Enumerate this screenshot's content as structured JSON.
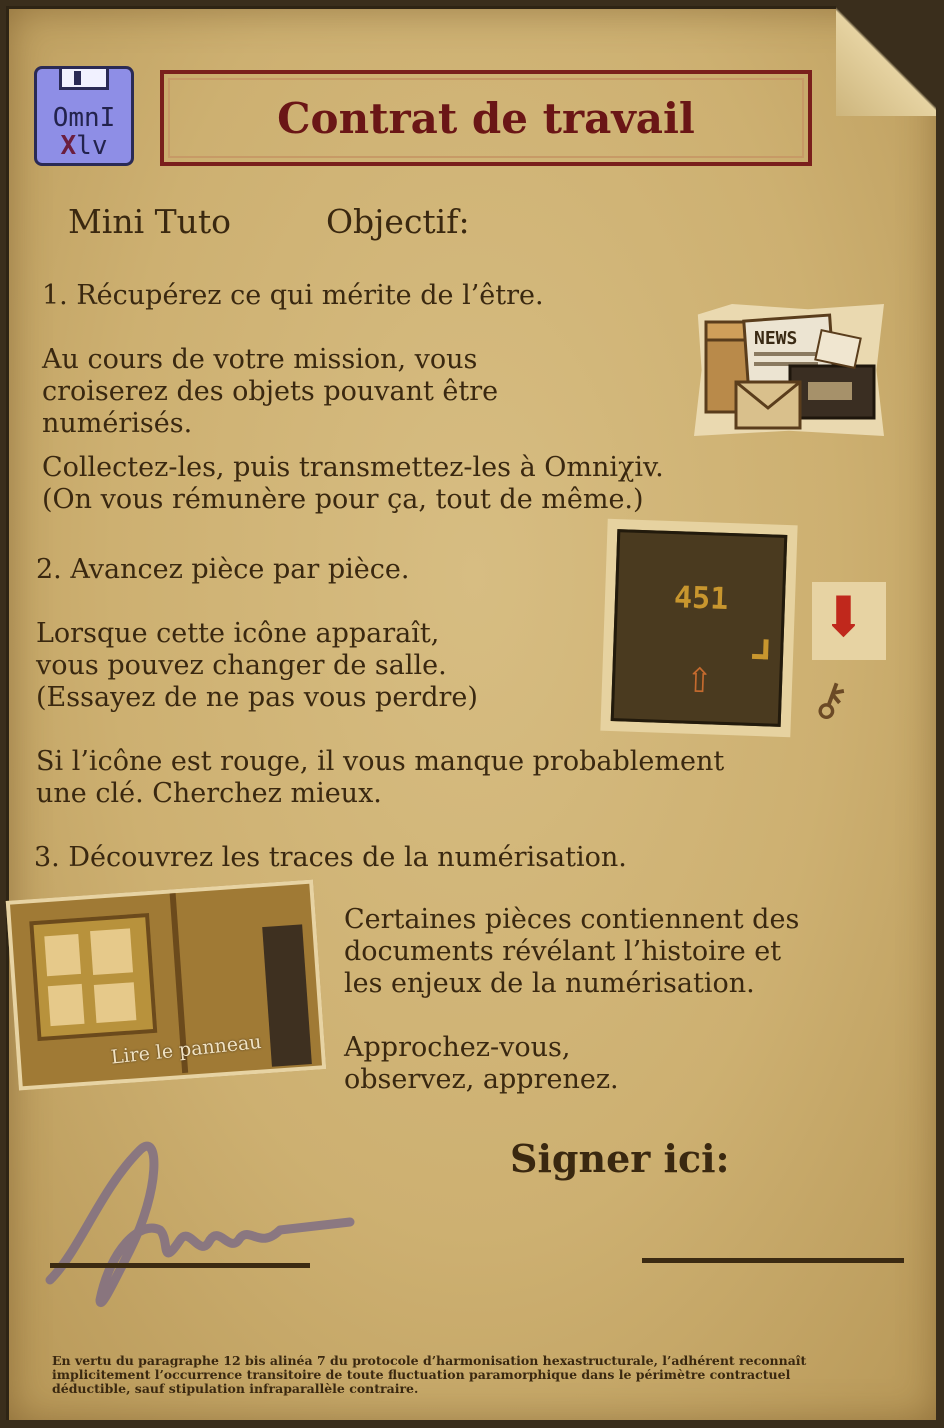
{
  "logo": {
    "line1": "OmnI",
    "line2_a": "X",
    "line2_b": "lv"
  },
  "title": "Contrat de travail",
  "headings": {
    "mini_tuto": "Mini Tuto",
    "objectif": "Objectif:"
  },
  "step1": {
    "heading": "1. Récupérez ce qui mérite de l’être.",
    "p1": [
      "Au cours de votre mission, vous",
      "croiserez des objets pouvant être",
      "numérisés."
    ],
    "p2": [
      "Collectez-les, puis transmettez-les à Omniχiv.",
      "(On vous rémunère pour ça, tout de même.)"
    ],
    "image_label": "NEWS"
  },
  "step2": {
    "heading": "2. Avancez pièce par pièce.",
    "p1": [
      "Lorsque cette icône apparaît,",
      "vous pouvez changer de salle.",
      "(Essayez de ne pas vous perdre)"
    ],
    "p2": [
      "Si l’icône est rouge, il vous manque probablement",
      "une clé. Cherchez mieux."
    ],
    "door_number": "451"
  },
  "step3": {
    "heading": "3. Découvrez les traces de la numérisation.",
    "p1": [
      "Certaines pièces contiennent des",
      "documents révélant l’histoire et",
      "les enjeux de la numérisation."
    ],
    "p2": [
      "Approchez-vous,",
      "observez, apprenez."
    ],
    "panel_label": "Lire le panneau"
  },
  "sign_label": "Signer ici:",
  "fine_print": [
    "En vertu du paragraphe 12 bis alinéa 7 du protocole d’harmonisation hexastructurale, l’adhérent reconnaît",
    "implicitement l’occurrence transitoire de toute fluctuation paramorphique dans le périmètre contractuel",
    "déductible, sauf stipulation infraparallèle contraire."
  ],
  "colors": {
    "paper": "#cdb071",
    "title_red": "#6a1616",
    "logo_blue": "#8e8ee6",
    "ink": "#3a2810",
    "signature": "#7a6a86"
  },
  "icons": [
    "floppy-disk-logo",
    "news-box",
    "door",
    "red-arrow",
    "key",
    "signature"
  ]
}
